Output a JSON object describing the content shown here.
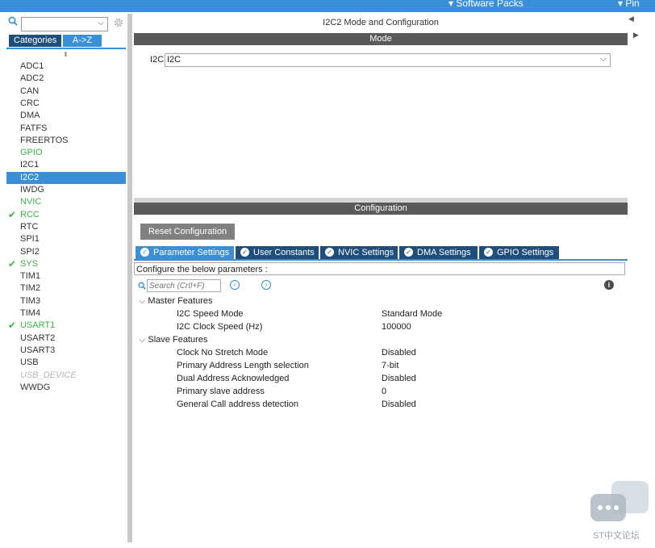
{
  "topbar": {
    "software_packs": "Software Packs",
    "pinout": "Pin"
  },
  "left": {
    "categories_tab": "Categories",
    "az_tab": "A->Z",
    "items": [
      {
        "label": "ADC1",
        "state": "normal"
      },
      {
        "label": "ADC2",
        "state": "normal"
      },
      {
        "label": "CAN",
        "state": "normal"
      },
      {
        "label": "CRC",
        "state": "normal"
      },
      {
        "label": "DMA",
        "state": "normal"
      },
      {
        "label": "FATFS",
        "state": "normal"
      },
      {
        "label": "FREERTOS",
        "state": "normal"
      },
      {
        "label": "GPIO",
        "state": "green"
      },
      {
        "label": "I2C1",
        "state": "normal"
      },
      {
        "label": "I2C2",
        "state": "selected"
      },
      {
        "label": "IWDG",
        "state": "normal"
      },
      {
        "label": "NVIC",
        "state": "green"
      },
      {
        "label": "RCC",
        "state": "checked"
      },
      {
        "label": "RTC",
        "state": "normal"
      },
      {
        "label": "SPI1",
        "state": "normal"
      },
      {
        "label": "SPI2",
        "state": "normal"
      },
      {
        "label": "SYS",
        "state": "checked"
      },
      {
        "label": "TIM1",
        "state": "normal"
      },
      {
        "label": "TIM2",
        "state": "normal"
      },
      {
        "label": "TIM3",
        "state": "normal"
      },
      {
        "label": "TIM4",
        "state": "normal"
      },
      {
        "label": "USART1",
        "state": "checked"
      },
      {
        "label": "USART2",
        "state": "normal"
      },
      {
        "label": "USART3",
        "state": "normal"
      },
      {
        "label": "USB",
        "state": "normal"
      },
      {
        "label": "USB_DEVICE",
        "state": "disabled"
      },
      {
        "label": "WWDG",
        "state": "normal"
      }
    ]
  },
  "main": {
    "title": "I2C2 Mode and Configuration",
    "mode_header": "Mode",
    "i2c_label": "I2C",
    "i2c_value": "I2C",
    "config_header": "Configuration",
    "reset_button": "Reset Configuration",
    "tabs": [
      "Parameter Settings",
      "User Constants",
      "NVIC Settings",
      "DMA Settings",
      "GPIO Settings"
    ],
    "configure_text": "Configure the below parameters :",
    "search_placeholder": "Search (Crtl+F)",
    "groups": [
      {
        "name": "Master Features",
        "params": [
          {
            "name": "I2C Speed Mode",
            "value": "Standard Mode"
          },
          {
            "name": "I2C Clock Speed (Hz)",
            "value": "100000"
          }
        ]
      },
      {
        "name": "Slave Features",
        "params": [
          {
            "name": "Clock No Stretch Mode",
            "value": "Disabled"
          },
          {
            "name": "Primary Address Length selection",
            "value": "7-bit"
          },
          {
            "name": "Dual Address Acknowledged",
            "value": "Disabled"
          },
          {
            "name": "Primary slave address",
            "value": "0"
          },
          {
            "name": "General Call address detection",
            "value": "Disabled"
          }
        ]
      }
    ]
  },
  "watermark": "ST中文论坛",
  "colors": {
    "accent": "#3a8fd6",
    "dark_tab": "#1f4e7a",
    "green": "#3cb14a",
    "header": "#5a5a5a"
  },
  "icons": [
    "search-icon",
    "gear-icon",
    "check-icon",
    "info-icon",
    "chevron-down-icon",
    "chat-icon"
  ]
}
